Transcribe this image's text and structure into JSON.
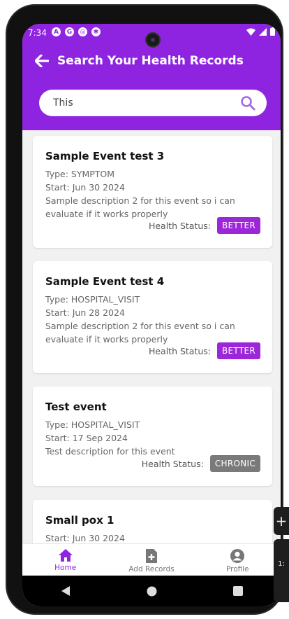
{
  "status_bar": {
    "time": "7:34",
    "left_icons": [
      "A",
      "G",
      "◎",
      "✱"
    ]
  },
  "header": {
    "title": "Search Your Health Records",
    "accent": "#8e24e0"
  },
  "search": {
    "value": "This",
    "placeholder": ""
  },
  "records": [
    {
      "title": "Sample Event test 3",
      "type": "Type: SYMPTOM",
      "start": "Start: Jun 30 2024",
      "description": [
        "Sample description 2 for this event so i can",
        "evaluate if it works properly"
      ],
      "status_label": "Health Status:",
      "status": "BETTER",
      "status_color": "#9c27d9"
    },
    {
      "title": "Sample Event test 4",
      "type": "Type: HOSPITAL_VISIT",
      "start": "Start: Jun 28 2024",
      "description": [
        "Sample description 2 for this event so i can",
        "evaluate if it works properly"
      ],
      "status_label": "Health Status:",
      "status": "BETTER",
      "status_color": "#9c27d9"
    },
    {
      "title": "Test event",
      "type": "Type: HOSPITAL_VISIT",
      "start": "Start: 17 Sep 2024",
      "description": [
        "Test description for this event"
      ],
      "status_label": "Health Status:",
      "status": "CHRONIC",
      "status_color": "#7a7a7a"
    },
    {
      "title": "Small pox 1",
      "start": "Start: Jun 30 2024"
    }
  ],
  "bottom_nav": {
    "items": [
      {
        "label": "Home",
        "icon": "home-icon",
        "active": true
      },
      {
        "label": "Add Records",
        "icon": "add-document-icon",
        "active": false
      },
      {
        "label": "Profile",
        "icon": "profile-icon",
        "active": false
      }
    ],
    "active_color": "#8e24e0",
    "inactive_color": "#777777"
  },
  "side_tools": {
    "plus": "+",
    "ratio": "1:"
  }
}
